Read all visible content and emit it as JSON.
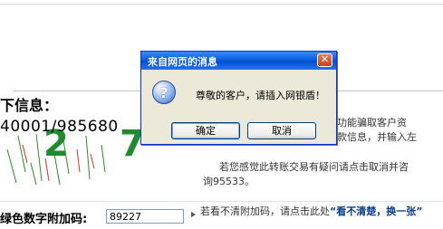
{
  "page": {
    "heading": "下信息：",
    "account_number": "40001/985680",
    "captcha_digits": [
      "2",
      "7"
    ],
    "info_right": [
      "功能骗取客户资",
      "款信息，并输入左"
    ],
    "info_lower_1": "若您感觉此转账交易有疑问请点击取消并咨",
    "info_lower_2": "询95533。",
    "code_label": "绿色数字附加码:",
    "code_value": "89227",
    "hint_text": "若看不清附加码，请点击此处",
    "hint_link": "“看不清楚，换一张”"
  },
  "dialog": {
    "title": "来自网页的消息",
    "message": "尊敬的客户，请插入网银盾！",
    "ok_label": "确定",
    "cancel_label": "取消",
    "icon": "question-icon",
    "close_icon": "close-icon"
  }
}
